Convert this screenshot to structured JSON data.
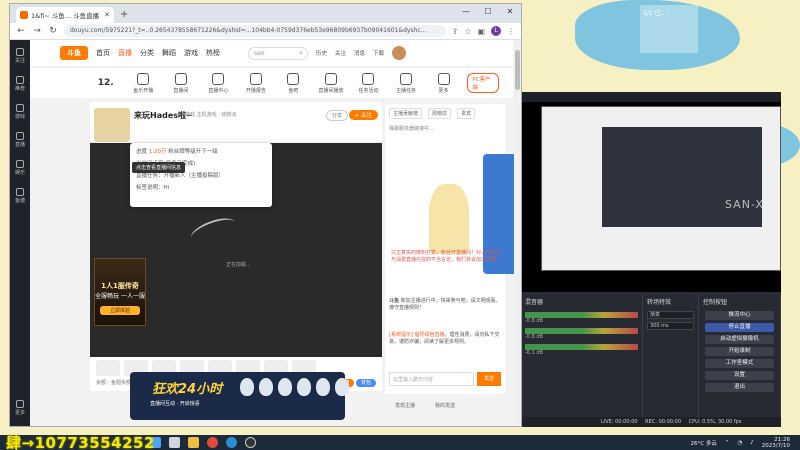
{
  "desktop": {
    "overlay_note": "肆→10773554252",
    "sticky_text": "1/1 已.. :"
  },
  "browser": {
    "tab_title": "1&fi~ 斗鱼... 斗鱼直播 - 5 选项",
    "url": "douyu.com/5975221?_t=..0.2654378558671226&dyshid=...104bb4-0759d376eb53e96809b6937b09041601&dyshc...",
    "window_controls": [
      "—",
      "☐",
      "✕"
    ]
  },
  "left_rail": {
    "items": [
      "关注",
      "推荐",
      "游戏",
      "直播",
      "娱乐",
      "鱼塘"
    ],
    "bottom": "更多"
  },
  "site_header": {
    "logo": "斗鱼",
    "nav": [
      "首页",
      "直播",
      "分类",
      "舞蹈",
      "游戏",
      "热榜"
    ],
    "active_nav": 1,
    "search_placeholder": "seo",
    "icons": [
      "历史",
      "关注",
      "消息",
      "下载"
    ]
  },
  "fav_bar": {
    "level": "12.",
    "level_sub": "直播专区",
    "items": [
      "直播专区",
      "鱼乐开播",
      "直播间",
      "直播中心",
      "开播报告",
      "鱼吧",
      "直播间播放",
      "任务活动",
      "主播任务",
      "更多"
    ],
    "pc_button": "PC客户端"
  },
  "room": {
    "title": "来玩Hades啦~",
    "meta": "游戏  主机游戏 · 动物派",
    "tooltip": "点击查看直播间信息",
    "share": "分享",
    "follow": "+ 关注"
  },
  "player": {
    "overlay_line1_prefix": "进度",
    "overlay_line1_value": "1.20万",
    "overlay_line1_suffix": "粉丝牌等级升下一级",
    "overlay_line2": "当前已点亮(任务已完成)",
    "overlay_line3": "直播任务：开播新人（主播投稿版）",
    "overlay_line4": "标签说明：Hi",
    "loading": "正在加载...",
    "promo_title": "1人1服传奇",
    "promo_sub": "全服畅玩 一人一服",
    "promo_btn": "立即体验"
  },
  "gift_bar": {
    "left_text": "余额：鱼翅余额 0",
    "pay": "充值",
    "charge": "背包"
  },
  "banner": {
    "title": "狂欢24小时",
    "subtitle": "直播间互动 · 开启惊喜",
    "eggs": [
      "10万",
      "10万",
      "10万",
      "10万",
      "10万",
      "10万"
    ]
  },
  "chat": {
    "tabs": [
      "主播贡献榜",
      "周榜前",
      "贵宾"
    ],
    "notice": "弹幕服务器链接中...",
    "message": "只正真实的微粉打赏，粉丝开直播间！对人身攻击与消费直播内容的不当言论，我们将会加以处理。",
    "hero_name": "斗鱼",
    "hero_text": "新加主播进行中，快来参与吧，请文明观看，遵守直播规则！",
    "warn_label": "[系统提示]",
    "warn_highlight": "倡导绿色直播",
    "warn_text": "，理性消费，请勿私下交易，谨防诈骗，阅读了解更多规则。",
    "input_placeholder": "这里输入聊天内容",
    "send": "发送"
  },
  "below_chat": [
    "发现主播",
    "我的发送"
  ],
  "obs": {
    "mixer_title": "混音器",
    "mixer_meters": [
      "-0.8 dB",
      "-0.8 dB",
      "-6.1 dB"
    ],
    "transition_title": "转场特效",
    "transition_type": "渐变",
    "transition_duration": "300 ms",
    "controls_title": "控制按钮",
    "controls": [
      "推流中心",
      "停止直播",
      "启动虚拟摄像机",
      "开始录制",
      "工作室模式",
      "设置",
      "退出"
    ],
    "status": [
      "LIVE: 00:00:00",
      "REC: 00:00:00",
      "CPU: 0.5%, 30.00 fps"
    ],
    "watermark": "SAN-X"
  },
  "taskbar": {
    "weather": "26°C 多云",
    "time": "21:26",
    "date": "2023/7/10"
  }
}
